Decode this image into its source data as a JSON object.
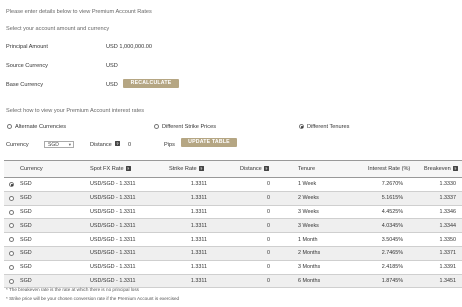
{
  "intro": {
    "heading": "Please enter details below to view Premium Account Rates",
    "sub": "Select your account amount and currency"
  },
  "fields": {
    "principal_label": "Principal Amount",
    "principal_value": "USD  1,000,000.00",
    "source_label": "Source Currency",
    "source_value": "USD",
    "base_label": "Base Currency",
    "base_value": "USD",
    "recalc_button": "RECALCULATE"
  },
  "view": {
    "heading": "Select how to view your Premium Account interest rates",
    "option_alternate": "Alternate Currencies",
    "option_strike": "Different Strike Prices",
    "option_tenures": "Different Tenures",
    "selected": "tenures",
    "currency_label": "Currency",
    "currency_value": "SGD",
    "distance_label": "Distance",
    "distance_value": "0",
    "pips_label": "Pips",
    "update_button": "UPDATE TABLE"
  },
  "table": {
    "headers": {
      "currency": "Currency",
      "spot": "Spot FX Rate",
      "strike": "Strike Rate",
      "distance": "Distance",
      "tenure": "Tenure",
      "interest": "Interest Rate (%)",
      "breakeven": "Breakeven"
    },
    "rows": [
      {
        "currency": "SGD",
        "spot": "USD/SGD - 1.3311",
        "strike": "1.3311",
        "distance": "0",
        "tenure": "1 Week",
        "interest": "7.2670%",
        "breakeven": "1.3330",
        "selected": true
      },
      {
        "currency": "SGD",
        "spot": "USD/SGD - 1.3311",
        "strike": "1.3311",
        "distance": "0",
        "tenure": "2 Weeks",
        "interest": "5.1615%",
        "breakeven": "1.3337",
        "selected": false
      },
      {
        "currency": "SGD",
        "spot": "USD/SGD - 1.3311",
        "strike": "1.3311",
        "distance": "0",
        "tenure": "3 Weeks",
        "interest": "4.4525%",
        "breakeven": "1.3346",
        "selected": false
      },
      {
        "currency": "SGD",
        "spot": "USD/SGD - 1.3311",
        "strike": "1.3311",
        "distance": "0",
        "tenure": "3 Weeks",
        "interest": "4.0345%",
        "breakeven": "1.3344",
        "selected": false
      },
      {
        "currency": "SGD",
        "spot": "USD/SGD - 1.3311",
        "strike": "1.3311",
        "distance": "0",
        "tenure": "1 Month",
        "interest": "3.5045%",
        "breakeven": "1.3350",
        "selected": false
      },
      {
        "currency": "SGD",
        "spot": "USD/SGD - 1.3311",
        "strike": "1.3311",
        "distance": "0",
        "tenure": "2 Months",
        "interest": "2.7465%",
        "breakeven": "1.3371",
        "selected": false
      },
      {
        "currency": "SGD",
        "spot": "USD/SGD - 1.3311",
        "strike": "1.3311",
        "distance": "0",
        "tenure": "3 Months",
        "interest": "2.4185%",
        "breakeven": "1.3391",
        "selected": false
      },
      {
        "currency": "SGD",
        "spot": "USD/SGD - 1.3311",
        "strike": "1.3311",
        "distance": "0",
        "tenure": "6 Months",
        "interest": "1.8745%",
        "breakeven": "1.3451",
        "selected": false
      }
    ]
  },
  "footnotes": {
    "one": "* The breakeven rate is the rate at which there is no principal loss",
    "two": "* Strike price will be your chosen conversion rate if the Premium Account is exercised"
  },
  "colors": {
    "button": "#b5a683",
    "row_alt": "#efefef"
  }
}
